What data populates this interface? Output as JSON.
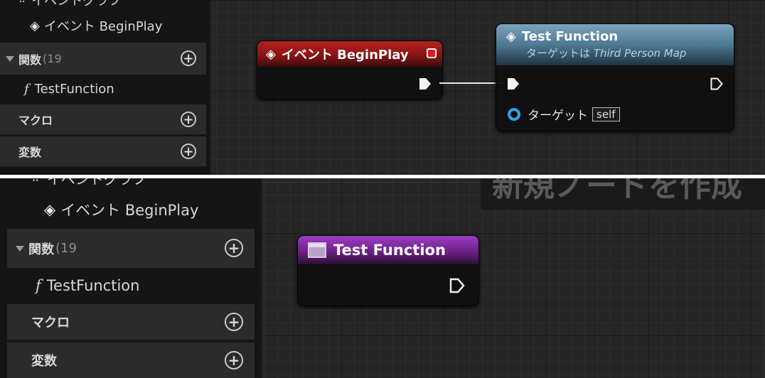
{
  "top": {
    "sidebar": {
      "partial_header": "イベントグラフ",
      "event_item": "イベント BeginPlay",
      "functions": {
        "label": "関数",
        "count": "(19"
      },
      "function_item": "TestFunction",
      "macros": {
        "label": "マクロ"
      },
      "variables": {
        "label": "変数"
      }
    },
    "begin_play_node": {
      "title": "イベント BeginPlay",
      "header_color": "#9a1616"
    },
    "test_function_node": {
      "title": "Test Function",
      "subtitle_prefix": "ターゲットは ",
      "subtitle_target": "Third Person Map",
      "target_pin_label": "ターゲット",
      "target_pin_value": "self",
      "header_color": "#5c8aa6"
    }
  },
  "bottom": {
    "sidebar": {
      "partial_header": "イベントグラフ",
      "event_item": "イベント BeginPlay",
      "functions": {
        "label": "関数",
        "count": "(19"
      },
      "function_item": "TestFunction",
      "macros": {
        "label": "マクロ"
      },
      "variables": {
        "label": "変数"
      }
    },
    "toast_text": "新規ノードを作成",
    "function_entry_node": {
      "title": "Test Function",
      "header_color": "#7a2a9a"
    }
  }
}
